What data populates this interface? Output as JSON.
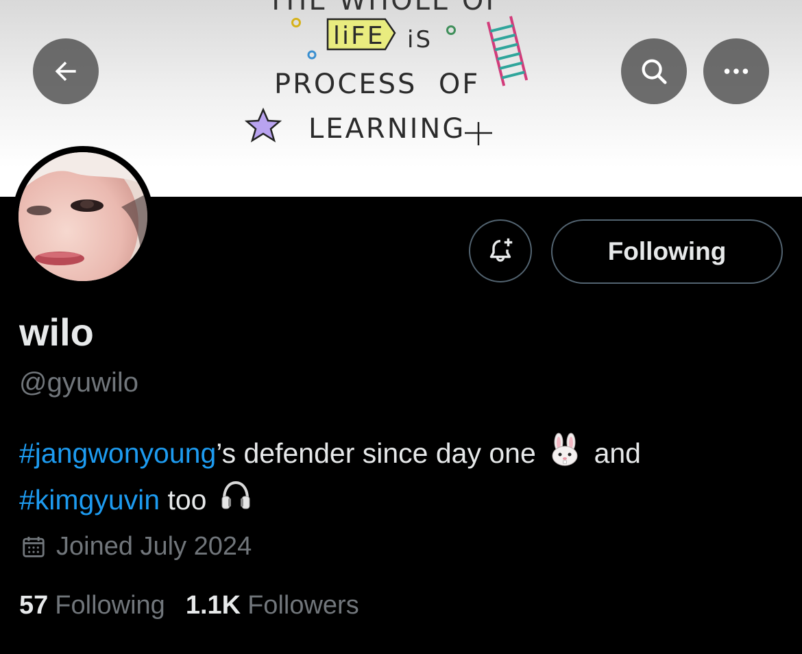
{
  "banner": {
    "line1": "THE WHOLE OF",
    "life_word": "liFE",
    "is_word": "iS",
    "line3": "PROCESS  OF",
    "line4": "LEARNING"
  },
  "nav": {
    "back_icon": "arrow-left-icon",
    "search_icon": "search-icon",
    "more_icon": "ellipsis-icon"
  },
  "actions": {
    "bell_icon": "bell-plus-icon",
    "following_label": "Following"
  },
  "profile": {
    "display_name": "wilo",
    "handle": "@gyuwilo",
    "bio": {
      "hashtag1": "#jangwonyoung",
      "text1": "’s defender since day one",
      "emoji1": "rabbit-face",
      "text2": " and",
      "hashtag2": "#kimgyuvin",
      "text3": " too",
      "emoji2": "headphones"
    },
    "joined": "Joined July 2024",
    "following_count": "57",
    "following_label": "Following",
    "followers_count": "1.1K",
    "followers_label": "Followers"
  },
  "colors": {
    "background": "#000000",
    "accent": "#1d9bf0",
    "secondary_text": "#71767b",
    "primary_text": "#e7e9ea",
    "border": "#536471"
  }
}
